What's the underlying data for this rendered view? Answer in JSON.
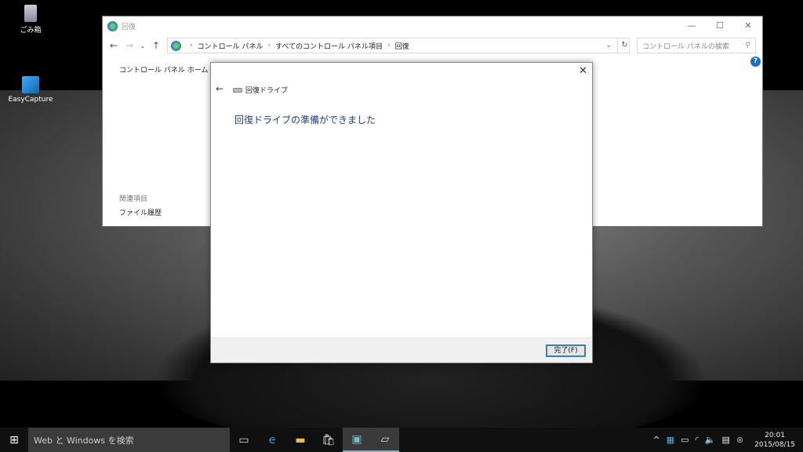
{
  "desktop": {
    "icons": [
      {
        "label": "ごみ箱"
      },
      {
        "label": "EasyCapture"
      }
    ]
  },
  "window": {
    "title": "回復",
    "breadcrumb": [
      "コントロール パネル",
      "すべてのコントロール パネル項目",
      "回復"
    ],
    "search_placeholder": "コントロール パネルの検索",
    "sidebar_home": "コントロール パネル ホーム",
    "related_heading": "関連項目",
    "related_link": "ファイル履歴"
  },
  "dialog": {
    "title": "回復ドライブ",
    "heading": "回復ドライブの準備ができました",
    "finish_label": "完了(F)"
  },
  "taskbar": {
    "search_placeholder": "Web と Windows を検索",
    "time": "20:01",
    "date": "2015/08/15"
  }
}
